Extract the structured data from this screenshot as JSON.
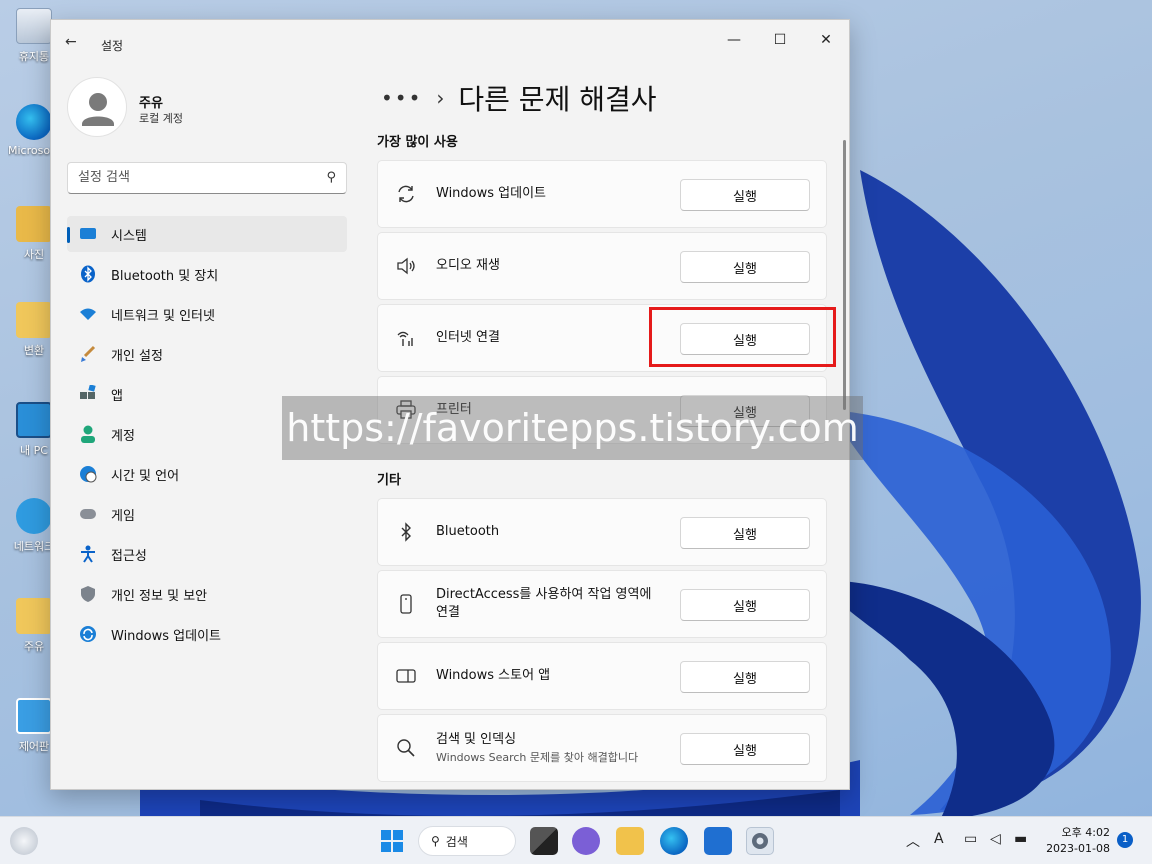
{
  "desktop": {
    "icons": [
      "휴지통",
      "Microsoft Edge",
      "사진",
      "변환",
      "내 PC",
      "네트워크",
      "주유",
      "제어판"
    ]
  },
  "window": {
    "title": "설정",
    "minimize": "—",
    "maximize": "☐",
    "close": "✕"
  },
  "user": {
    "name": "주유",
    "account_type": "로컬 계정"
  },
  "search": {
    "placeholder": "설정 검색"
  },
  "sidebar": {
    "items": [
      {
        "label": "시스템",
        "icon": "system-icon"
      },
      {
        "label": "Bluetooth 및 장치",
        "icon": "bluetooth-icon"
      },
      {
        "label": "네트워크 및 인터넷",
        "icon": "wifi-icon"
      },
      {
        "label": "개인 설정",
        "icon": "brush-icon"
      },
      {
        "label": "앱",
        "icon": "apps-icon"
      },
      {
        "label": "계정",
        "icon": "account-icon"
      },
      {
        "label": "시간 및 언어",
        "icon": "globe-clock-icon"
      },
      {
        "label": "게임",
        "icon": "gamepad-icon"
      },
      {
        "label": "접근성",
        "icon": "accessibility-icon"
      },
      {
        "label": "개인 정보 및 보안",
        "icon": "shield-icon"
      },
      {
        "label": "Windows 업데이트",
        "icon": "update-icon"
      }
    ]
  },
  "main": {
    "breadcrumb_more": "•••",
    "breadcrumb_sep": "›",
    "page_title": "다른 문제 해결사",
    "sections": [
      {
        "title": "가장 많이 사용",
        "items": [
          {
            "label": "Windows 업데이트",
            "button": "실행"
          },
          {
            "label": "오디오 재생",
            "button": "실행"
          },
          {
            "label": "인터넷 연결",
            "button": "실행"
          },
          {
            "label": "프린터",
            "button": "실행"
          }
        ]
      },
      {
        "title": "기타",
        "items": [
          {
            "label": "Bluetooth",
            "button": "실행"
          },
          {
            "label": "DirectAccess를 사용하여 작업 영역에 연결",
            "button": "실행"
          },
          {
            "label": "Windows 스토어 앱",
            "button": "실행"
          },
          {
            "label": "검색 및 인덱싱",
            "description": "Windows Search 문제를 찾아 해결합니다",
            "button": "실행"
          }
        ]
      }
    ]
  },
  "watermark": "https://favoritepps.tistory.com",
  "taskbar": {
    "search_label": "검색",
    "ime": "A",
    "time": "오후 4:02",
    "date": "2023-01-08",
    "notifications": "1"
  },
  "colors": {
    "accent": "#005fb8",
    "highlight_box": "#e51a1a"
  }
}
